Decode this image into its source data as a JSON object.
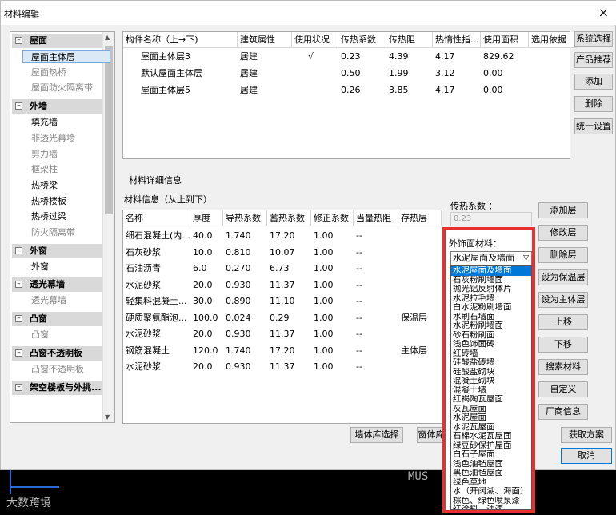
{
  "window": {
    "title": "材料编辑",
    "close": "×"
  },
  "tree": {
    "groups": [
      {
        "label": "屋面",
        "items": [
          {
            "label": "屋面主体层",
            "state": "sel"
          },
          {
            "label": "屋面热桥",
            "state": "dim"
          },
          {
            "label": "屋面防火隔离带",
            "state": "dim"
          }
        ]
      },
      {
        "label": "外墙",
        "items": [
          {
            "label": "填充墙",
            "state": ""
          },
          {
            "label": "非透光幕墙",
            "state": "dim"
          },
          {
            "label": "剪力墙",
            "state": "dim"
          },
          {
            "label": "框架柱",
            "state": "dim"
          },
          {
            "label": "热桥梁",
            "state": ""
          },
          {
            "label": "热桥楼板",
            "state": ""
          },
          {
            "label": "热桥过梁",
            "state": ""
          },
          {
            "label": "防火隔离带",
            "state": "dim"
          }
        ]
      },
      {
        "label": "外窗",
        "items": [
          {
            "label": "外窗",
            "state": ""
          }
        ]
      },
      {
        "label": "透光幕墙",
        "items": [
          {
            "label": "透光幕墙",
            "state": "dim"
          }
        ]
      },
      {
        "label": "凸窗",
        "items": [
          {
            "label": "凸窗",
            "state": "dim"
          }
        ]
      },
      {
        "label": "凸窗不透明板",
        "items": [
          {
            "label": "凸窗不透明板",
            "state": "dim"
          }
        ]
      },
      {
        "label": "架空楼板与外挑...",
        "items": []
      }
    ]
  },
  "components": {
    "headers": [
      "构件名称（上→下)",
      "建筑属性",
      "使用状况",
      "传热系数",
      "传热阻",
      "热惰性指...",
      "使用面积",
      "选用依据"
    ],
    "rows": [
      [
        "屋面主体层3",
        "居建",
        "√",
        "0.23",
        "4.39",
        "4.17",
        "829.62",
        ""
      ],
      [
        "默认屋面主体层",
        "居建",
        "",
        "0.50",
        "1.99",
        "3.12",
        "0.00",
        ""
      ],
      [
        "屋面主体层5",
        "居建",
        "",
        "0.26",
        "3.85",
        "4.17",
        "0.00",
        ""
      ]
    ]
  },
  "right_buttons": [
    "系统选择",
    "产品推荐",
    "添加",
    "删除",
    "统一设置"
  ],
  "detail": {
    "section_label": "材料详细信息",
    "list_label": "材料信息（从上到下）",
    "headers": [
      "名称",
      "厚度",
      "导热系数",
      "蓄热系数",
      "修正系数",
      "当量热阻",
      "存热层"
    ],
    "rows": [
      [
        "细石混凝土(内...",
        "40.0",
        "1.740",
        "17.20",
        "1.00",
        "--",
        ""
      ],
      [
        "石灰砂浆",
        "10.0",
        "0.810",
        "10.07",
        "1.00",
        "--",
        ""
      ],
      [
        "石油沥青",
        "6.0",
        "0.270",
        "6.73",
        "1.00",
        "--",
        ""
      ],
      [
        "水泥砂浆",
        "20.0",
        "0.930",
        "11.37",
        "1.00",
        "--",
        ""
      ],
      [
        "轻集料混凝土...",
        "30.0",
        "0.890",
        "11.10",
        "1.00",
        "--",
        ""
      ],
      [
        "硬质聚氨酯泡...",
        "100.0",
        "0.024",
        "0.29",
        "1.00",
        "--",
        "保温层"
      ],
      [
        "水泥砂浆",
        "20.0",
        "0.930",
        "11.37",
        "1.00",
        "--",
        ""
      ],
      [
        "钢筋混凝土",
        "120.0",
        "1.740",
        "17.20",
        "1.00",
        "--",
        "主体层"
      ],
      [
        "水泥砂浆",
        "20.0",
        "0.930",
        "11.37",
        "1.00",
        "--",
        ""
      ]
    ]
  },
  "heat": {
    "label": "传热系数 ：",
    "value": "0.23"
  },
  "finish": {
    "label": "外饰面材料：",
    "selected": "水泥屋面及墙面",
    "options": [
      "水泥屋面及墙面",
      "石灰粉刷墙面",
      "抛光铝反射体片",
      "水泥拉毛墙",
      "白水泥粉刷墙面",
      "水刷石墙面",
      "水泥粉刷墙面",
      "砂石粉刷面",
      "浅色饰面砖",
      "红砖墙",
      "硅酸盐砖墙",
      "硅酸盐砌块",
      "混凝土砌块",
      "混凝土墙",
      "红褐陶瓦屋面",
      "灰瓦屋面",
      "水泥屋面",
      "水泥瓦屋面",
      "石棉水泥瓦屋面",
      "绿豆砂保护屋面",
      "白石子屋面",
      "浅色油毡屋面",
      "黑色油毡屋面",
      "绿色草地",
      "水（开阔湖、海面）",
      "棕色、绿色喷泉漆",
      "红涂料、油漆"
    ]
  },
  "layer_buttons": [
    "添加层",
    "修改层",
    "删除层",
    "设为保温层",
    "设为主体层",
    "上移",
    "下移",
    "搜索材料",
    "自定义",
    "厂商信息"
  ],
  "bottom_buttons": {
    "wall_lib": "墙体库选择",
    "window_lib": "窗体库",
    "get_plan": "获取方案",
    "cancel": "取消"
  },
  "background": {
    "watermark": "大数跨境",
    "text": "MUS"
  }
}
